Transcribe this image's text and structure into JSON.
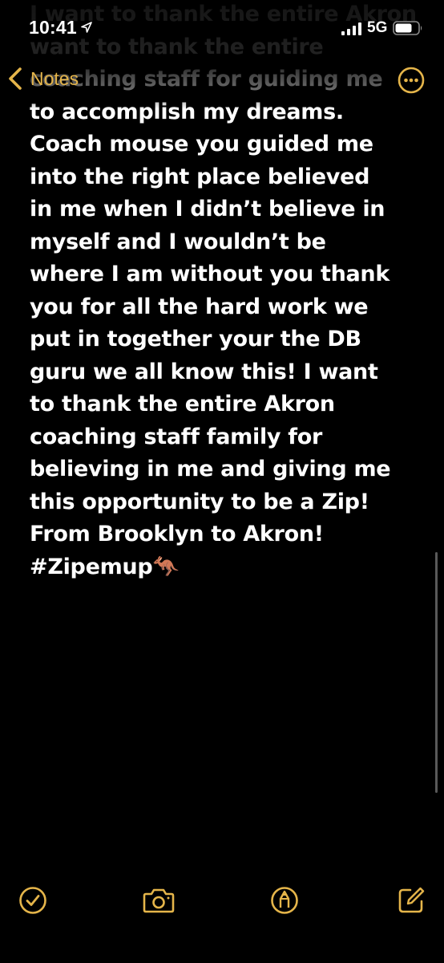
{
  "status_bar": {
    "time": "10:41",
    "network": "5G",
    "icons": [
      "location-arrow-icon",
      "cellular-signal-icon",
      "battery-icon"
    ]
  },
  "nav": {
    "back_label": "Notes",
    "back_icon": "chevron-left-icon",
    "more_icon": "ellipsis-circle-icon",
    "accent_color": "#e5b54a"
  },
  "note": {
    "text": "I want to thank the entire Akron\nwant to thank the entire\ncoaching staff for guiding me\nto accomplish my dreams.\nCoach mouse you guided me\ninto the right place believed\nin me when I didn’t believe in\nmyself and I wouldn’t be\nwhere I am without you thank\nyou for all the hard work we\nput in together your the DB\nguru we all know this! I want\nto thank the entire Akron\ncoaching staff family for\nbelieving in me and giving me\nthis opportunity to be a Zip!\nFrom Brooklyn to Akron!\n#Zipemup🦘"
  },
  "toolbar": {
    "items": [
      {
        "name": "checklist",
        "icon": "checkmark-circle-icon"
      },
      {
        "name": "camera",
        "icon": "camera-icon"
      },
      {
        "name": "markup",
        "icon": "markup-pen-circle-icon"
      },
      {
        "name": "compose",
        "icon": "compose-square-pencil-icon"
      }
    ]
  }
}
